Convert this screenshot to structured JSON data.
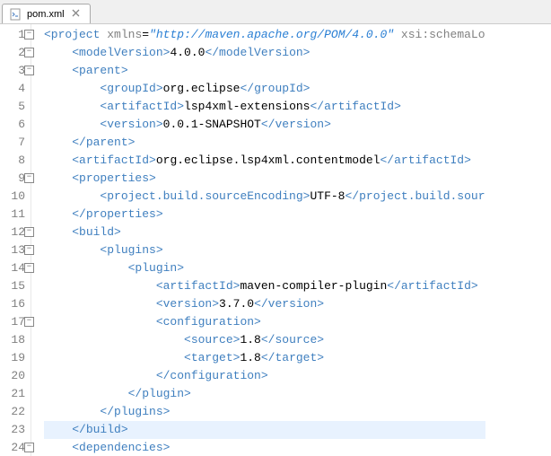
{
  "tab": {
    "filename": "pom.xml"
  },
  "gutter": {
    "count": 24
  },
  "fold_markers": [
    1,
    2,
    3,
    9,
    12,
    13,
    14,
    17,
    24
  ],
  "xml": {
    "project_open": "project",
    "xmlns_label": "xmlns",
    "xmlns_val": "\"http://maven.apache.org/POM/4.0.0\"",
    "xsi_label": "xsi:schemaLo",
    "modelVersion_tag": "modelVersion",
    "modelVersion_val": "4.0.0",
    "parent_tag": "parent",
    "groupId_tag": "groupId",
    "groupId_val": "org.eclipse",
    "artifactId_tag": "artifactId",
    "parent_artifactId_val": "lsp4xml-extensions",
    "version_tag": "version",
    "parent_version_val": "0.0.1-SNAPSHOT",
    "main_artifactId_val": "org.eclipse.lsp4xml.contentmodel",
    "properties_tag": "properties",
    "sourceEncoding_tag": "project.build.sourceEncoding",
    "sourceEncoding_val": "UTF-8",
    "sourceEncoding_close": "project.build.sour",
    "build_tag": "build",
    "plugins_tag": "plugins",
    "plugin_tag": "plugin",
    "compiler_artifactId_val": "maven-compiler-plugin",
    "compiler_version_val": "3.7.0",
    "configuration_tag": "configuration",
    "source_tag": "source",
    "source_val": "1.8",
    "target_tag": "target",
    "target_val": "1.8",
    "dependencies_tag": "dependencies"
  }
}
